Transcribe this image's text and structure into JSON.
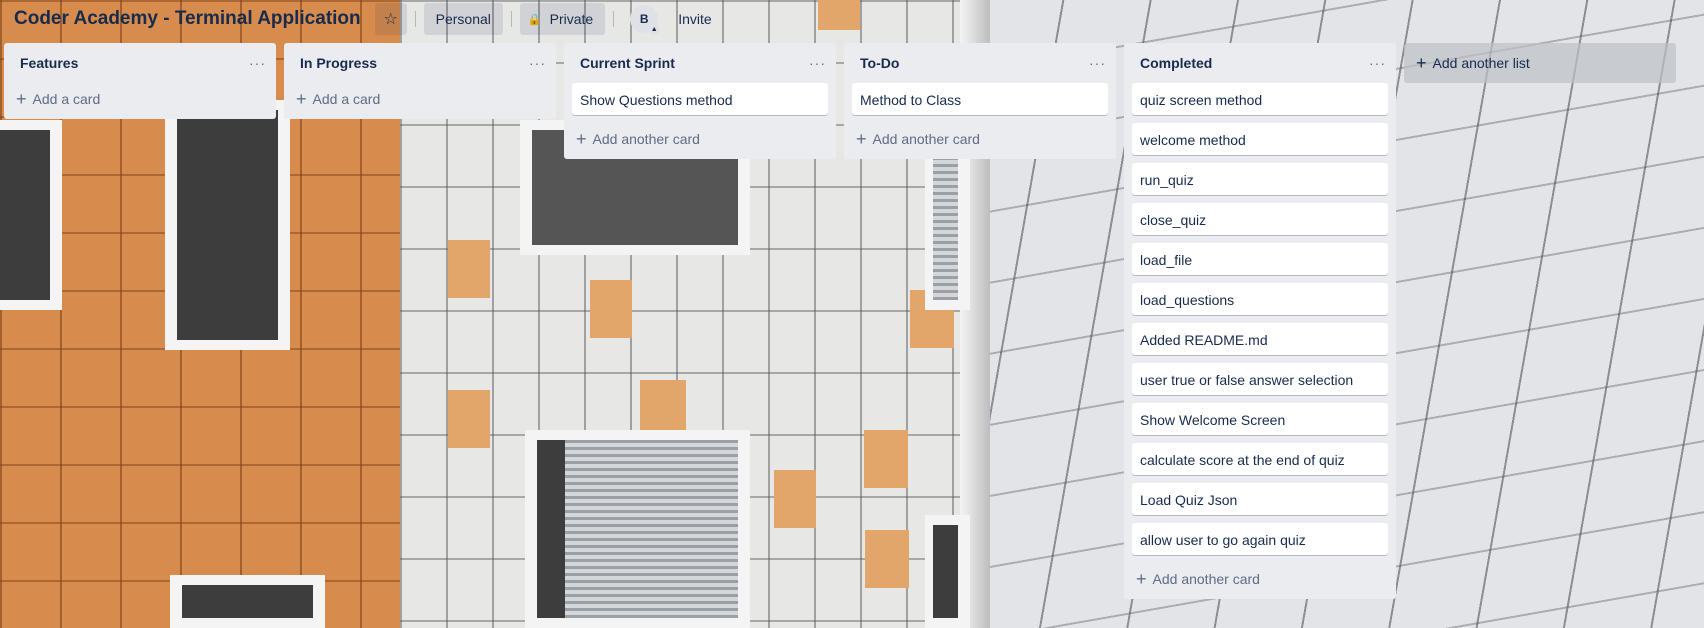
{
  "board": {
    "title": "Coder Academy - Terminal Application",
    "star_icon": "☆",
    "visibility_team": "Personal",
    "visibility_privacy": "Private",
    "lock_icon": "🔒",
    "avatar_initial": "B",
    "invite_label": "Invite"
  },
  "lists": [
    {
      "title": "Features",
      "menu": "···",
      "cards": [],
      "add_label": "Add a card"
    },
    {
      "title": "In Progress",
      "menu": "···",
      "cards": [],
      "add_label": "Add a card"
    },
    {
      "title": "Current Sprint",
      "menu": "···",
      "cards": [
        "Show Questions method"
      ],
      "add_label": "Add another card"
    },
    {
      "title": "To-Do",
      "menu": "···",
      "cards": [
        "Method to Class"
      ],
      "add_label": "Add another card"
    },
    {
      "title": "Completed",
      "menu": "···",
      "cards": [
        "quiz screen method",
        "welcome method",
        "run_quiz",
        "close_quiz",
        "load_file",
        "load_questions",
        "Added README.md",
        "user true or false answer selection",
        "Show Welcome Screen",
        "calculate score at the end of quiz",
        "Load Quiz Json",
        "allow user to go again quiz"
      ],
      "add_label": "Add another card"
    }
  ],
  "add_list_label": "Add another list",
  "plus_icon": "+"
}
